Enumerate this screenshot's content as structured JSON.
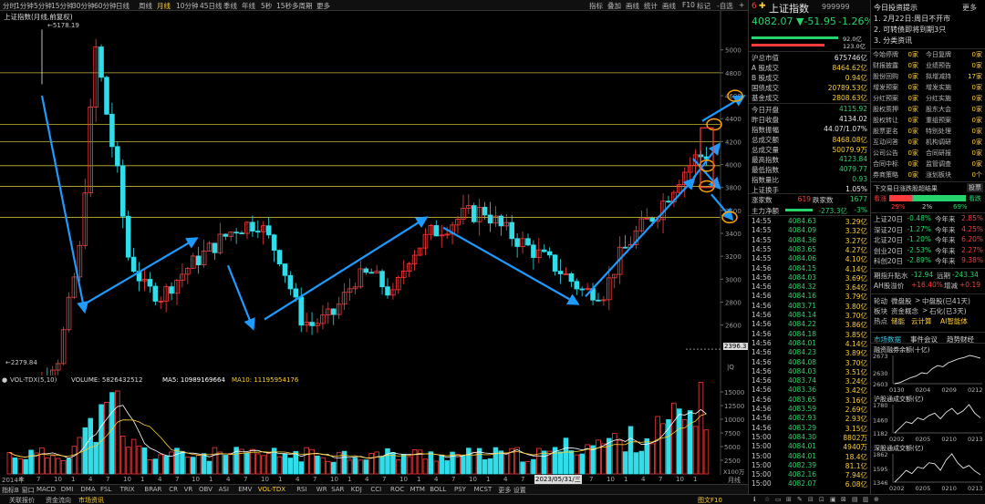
{
  "toolbar": {
    "timeframes": [
      "分时",
      "1分钟",
      "5分钟",
      "15分钟",
      "30分钟",
      "60分钟",
      "日线",
      "周线",
      "月线",
      "10分钟",
      "45日线",
      "季线",
      "年线",
      "5秒",
      "15秒",
      "多周期",
      "更多"
    ],
    "active_timeframe": "月线",
    "buttons": [
      "指标",
      "叠加",
      "画线",
      "统计",
      "画线",
      "F10",
      "标记",
      "-自选",
      "+"
    ]
  },
  "chart": {
    "title": "上证指数(月线,前复权)",
    "max_label": "5178.19",
    "min_label": "2279.84",
    "y_ticks": [
      "5000",
      "4800",
      "4600",
      "4400",
      "4200",
      "4000",
      "3800",
      "3600",
      "3400",
      "3200",
      "3000",
      "2800",
      "2600"
    ],
    "y_ticks_vals": [
      5000,
      4800,
      4600,
      4400,
      4200,
      4000,
      3800,
      3600,
      3400,
      3200,
      3000,
      2800,
      2600
    ],
    "right_value": "2396.3",
    "period_marker": "|Q",
    "x_labels": [
      "2014年",
      "4",
      "7",
      "10",
      "1",
      "4",
      "7",
      "10",
      "1",
      "4",
      "7",
      "10",
      "1",
      "4",
      "7",
      "10",
      "1",
      "4",
      "7",
      "10",
      "1",
      "4",
      "7",
      "10",
      "1",
      "4",
      "7",
      "10",
      "1",
      "4",
      "7",
      "10",
      "1",
      "4",
      "7",
      "10",
      "1",
      "4",
      "7",
      "10",
      "1"
    ],
    "date_highlight": "2023/05/31/三",
    "x_right": "月线",
    "vol_multiplier": "X100万"
  },
  "volume": {
    "header_prefix": "VOL-TDX(5,10)",
    "volume_label": "VOLUME: 5826432512",
    "ma5_label": "MA5: 10989169664",
    "ma10_label": "MA10: 11195954176",
    "y_ticks": [
      "15000",
      "12500",
      "10000",
      "7500",
      "5000",
      "2500"
    ]
  },
  "indicators": [
    "指标B",
    "窗口",
    "MACD",
    "DMI",
    "DMA",
    "FSL",
    "TRIX",
    "BRAR",
    "CR",
    "VR",
    "OBV",
    "ASI",
    "EMV",
    "VOL-TDX",
    "RSI",
    "WR",
    "SAR",
    "KDJ",
    "CCI",
    "ROC",
    "MTM",
    "BOLL",
    "PSY",
    "MCST",
    "更多",
    "设置"
  ],
  "active_indicator": "VOL-TDX",
  "statusbar": {
    "items": [
      "关联报价",
      "资金流向",
      "市场资讯"
    ],
    "active": "市场资讯",
    "right": "图文F10",
    "right_icons": [
      "ℹ",
      "☆",
      "▭",
      "⊞",
      "✎",
      "⊟",
      "⊡",
      "▣",
      "⊠",
      "▤",
      "▥",
      "⊕"
    ]
  },
  "quote": {
    "code_prefix": "6",
    "name": "上证指数",
    "code": "999999",
    "price": "4082.07",
    "change": "▼-51.95",
    "change_pct": "-1.26%",
    "bar_top_val": "92.0亿",
    "bar_bot_val": "123.0亿",
    "stats": [
      {
        "l": "沪总市值",
        "v": "675746亿",
        "c": "white"
      },
      {
        "l": "A 股成交",
        "v": "8464.62亿",
        "c": "yellow"
      },
      {
        "l": "B 股成交",
        "v": "0.94亿",
        "c": "yellow"
      },
      {
        "l": "国债成交",
        "v": "20789.53亿",
        "c": "yellow"
      },
      {
        "l": "基金成交",
        "v": "2808.63亿",
        "c": "yellow"
      },
      {
        "l": "今日开盘",
        "v": "4115.92",
        "c": "green"
      },
      {
        "l": "昨日收盘",
        "v": "4134.02",
        "c": "white"
      },
      {
        "l": "指数振幅",
        "v": "44.07/1.07%",
        "c": "white"
      },
      {
        "l": "总成交额",
        "v": "8468.08亿",
        "c": "yellow"
      },
      {
        "l": "总成交量",
        "v": "50079.9万",
        "c": "yellow"
      },
      {
        "l": "最高指数",
        "v": "4123.84",
        "c": "green"
      },
      {
        "l": "最低指数",
        "v": "4079.77",
        "c": "green"
      },
      {
        "l": "指数量比",
        "v": "0.93",
        "c": "green"
      },
      {
        "l": "上证换手",
        "v": "1.05%",
        "c": "white"
      }
    ],
    "up_label": "涨家数",
    "up_count": "619",
    "down_label": "跌家数",
    "down_count": "1677",
    "flow_label": "主力净额",
    "flow_value": "-273.3亿",
    "flow_pct": "-3%"
  },
  "ticks": [
    {
      "t": "14:55",
      "p": "4084.63",
      "v": "3.29亿"
    },
    {
      "t": "14:55",
      "p": "4084.09",
      "v": "3.32亿"
    },
    {
      "t": "14:55",
      "p": "4084.36",
      "v": "3.27亿"
    },
    {
      "t": "14:55",
      "p": "4083.65",
      "v": "4.27亿"
    },
    {
      "t": "14:55",
      "p": "4084.06",
      "v": "4.10亿"
    },
    {
      "t": "14:56",
      "p": "4084.15",
      "v": "4.14亿"
    },
    {
      "t": "14:56",
      "p": "4084.03",
      "v": "3.69亿"
    },
    {
      "t": "14:56",
      "p": "4084.32",
      "v": "3.64亿"
    },
    {
      "t": "14:56",
      "p": "4084.16",
      "v": "3.79亿"
    },
    {
      "t": "14:56",
      "p": "4083.71",
      "v": "3.80亿"
    },
    {
      "t": "14:56",
      "p": "4084.14",
      "v": "3.70亿"
    },
    {
      "t": "14:56",
      "p": "4084.22",
      "v": "3.86亿"
    },
    {
      "t": "14:56",
      "p": "4084.18",
      "v": "3.85亿"
    },
    {
      "t": "14:56",
      "p": "4084.01",
      "v": "4.14亿"
    },
    {
      "t": "14:56",
      "p": "4084.23",
      "v": "3.89亿"
    },
    {
      "t": "14:56",
      "p": "4084.08",
      "v": "3.70亿"
    },
    {
      "t": "14:56",
      "p": "4084.03",
      "v": "3.51亿"
    },
    {
      "t": "14:56",
      "p": "4083.74",
      "v": "3.24亿"
    },
    {
      "t": "14:56",
      "p": "4083.36",
      "v": "3.42亿"
    },
    {
      "t": "14:56",
      "p": "4083.65",
      "v": "3.16亿"
    },
    {
      "t": "14:56",
      "p": "4083.59",
      "v": "2.69亿"
    },
    {
      "t": "14:56",
      "p": "4082.93",
      "v": "2.93亿"
    },
    {
      "t": "14:56",
      "p": "4083.29",
      "v": "3.15亿"
    },
    {
      "t": "15:00",
      "p": "4084.30",
      "v": "8802万"
    },
    {
      "t": "15:00",
      "p": "4084.01",
      "v": "4940万"
    },
    {
      "t": "15:00",
      "p": "4084.01",
      "v": "18.4亿"
    },
    {
      "t": "15:00",
      "p": "4082.39",
      "v": "81.1亿"
    },
    {
      "t": "15:00",
      "p": "4082.16",
      "v": "7.94亿"
    },
    {
      "t": "15:00",
      "p": "4082.07",
      "v": "6.08亿"
    }
  ],
  "news": {
    "title": "今日投资提示",
    "more": "更多",
    "items": [
      "1. 2月22日:周日不开市",
      "2. 可转债即将到期3只",
      "3. 分类资讯"
    ]
  },
  "events": {
    "rows": [
      [
        "今始停牌",
        "0家",
        "今日复牌",
        "0家"
      ],
      [
        "财报披露",
        "0家",
        "业绩预告",
        "0家"
      ],
      [
        "股份回购",
        "0家",
        "拟增减持",
        "17家"
      ],
      [
        "增发预案",
        "0家",
        "增发实施",
        "0家"
      ],
      [
        "分红预案",
        "0家",
        "分红实施",
        "0家"
      ],
      [
        "股权质押",
        "0家",
        "股东大会",
        "0家"
      ],
      [
        "股权转让",
        "0家",
        "重组预案",
        "0家"
      ],
      [
        "股票更名",
        "0家",
        "特别处理",
        "0家"
      ],
      [
        "互动问答",
        "0家",
        "机构调研",
        "0家"
      ],
      [
        "公司公告",
        "0家",
        "合同研报",
        "0家"
      ],
      [
        "合同中标",
        "0家",
        "监管调查",
        "0家"
      ],
      [
        "券商策略",
        "0家",
        "涨划板块",
        "0个"
      ]
    ]
  },
  "breadth": {
    "title": "下交易日涨跌股超结果",
    "btn": "投票",
    "up_label": "看涨",
    "down_label": "看跌",
    "up_pct": 29,
    "mid_pct": 2,
    "down_pct": 69,
    "up_text": "29%",
    "mid_text": "2%",
    "down_text": "69%",
    "rows": [
      {
        "a": "上证20日",
        "b": "-0.48%",
        "c": "今年来",
        "d": "2.85%"
      },
      {
        "a": "深证20日",
        "b": "-1.27%",
        "c": "今年来",
        "d": "4.25%"
      },
      {
        "a": "北证20日",
        "b": "-1.20%",
        "c": "今年来",
        "d": "6.20%"
      },
      {
        "a": "创业20日",
        "b": "-2.53%",
        "c": "今年来",
        "d": "2.27%"
      },
      {
        "a": "科创20日",
        "b": "-2.89%",
        "c": "今年来",
        "d": "9.38%"
      }
    ],
    "futures1_label": "期指升贴水",
    "futures1_a": "-12.94",
    "futures1_b_label": "远期",
    "futures1_b": "-243.34",
    "futures2_label": "AH股溢价",
    "futures2_a": "+16.40%",
    "futures2_b_label": "增减",
    "futures2_b": "+0.19",
    "rot1_label": "轮动",
    "rot1_a": "微盘股",
    "rot1_b": "中盘股(已41天)",
    "rot2_label": "板块",
    "rot2_a": "资金概念",
    "rot2_b": "石化(已3天)",
    "hot_label": "热点",
    "hot_items": [
      "储能",
      "云计算",
      "AI智能体"
    ]
  },
  "tabs": {
    "items": [
      "市场数据",
      "事件会议",
      "趋势财经"
    ],
    "active": "市场数据"
  },
  "mini_charts": [
    {
      "title": "融资融券余额(十亿)",
      "y_ticks": [
        "2673",
        "2630",
        "2603"
      ],
      "x_ticks": [
        "0130",
        "0204",
        "0209",
        "0212"
      ],
      "series": [
        2603,
        2606,
        2612,
        2618,
        2622,
        2630,
        2628,
        2640,
        2648,
        2645,
        2655,
        2660,
        2665,
        2668,
        2673,
        2670,
        2666
      ]
    },
    {
      "title": "沪股通成交额(亿)",
      "y_ticks": [
        "1780",
        "1460",
        "1182"
      ],
      "x_ticks": [
        "0202",
        "0205",
        "0210",
        "0213"
      ],
      "series": [
        1182,
        1300,
        1420,
        1380,
        1500,
        1460,
        1550,
        1600,
        1480,
        1620,
        1700,
        1580,
        1650,
        1780,
        1600,
        1500
      ]
    },
    {
      "title": "深股通成交额(亿)",
      "y_ticks": [
        "1862",
        "1595",
        "1346"
      ],
      "x_ticks": [
        "0202",
        "0205",
        "0210",
        "0213"
      ],
      "series": [
        1346,
        1450,
        1560,
        1500,
        1620,
        1595,
        1700,
        1680,
        1560,
        1750,
        1862,
        1700,
        1600,
        1650,
        1550,
        1480
      ]
    }
  ]
}
